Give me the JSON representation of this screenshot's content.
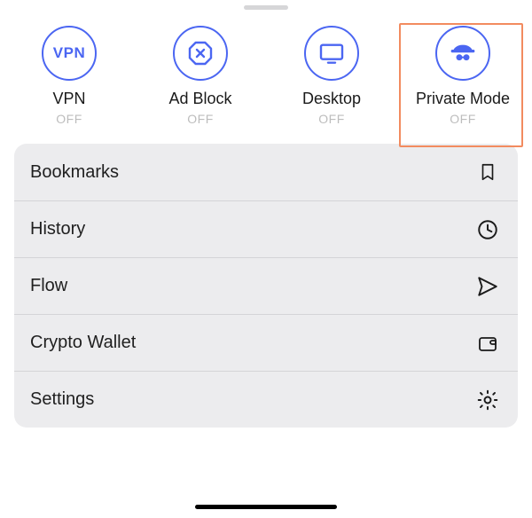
{
  "accent": "#4b66f2",
  "toggles": {
    "vpn": {
      "label": "VPN",
      "status": "OFF",
      "icon_text": "VPN"
    },
    "adblock": {
      "label": "Ad Block",
      "status": "OFF"
    },
    "desktop": {
      "label": "Desktop",
      "status": "OFF"
    },
    "private": {
      "label": "Private Mode",
      "status": "OFF"
    }
  },
  "menu": {
    "bookmarks": {
      "label": "Bookmarks"
    },
    "history": {
      "label": "History"
    },
    "flow": {
      "label": "Flow"
    },
    "crypto": {
      "label": "Crypto Wallet"
    },
    "settings": {
      "label": "Settings"
    }
  }
}
